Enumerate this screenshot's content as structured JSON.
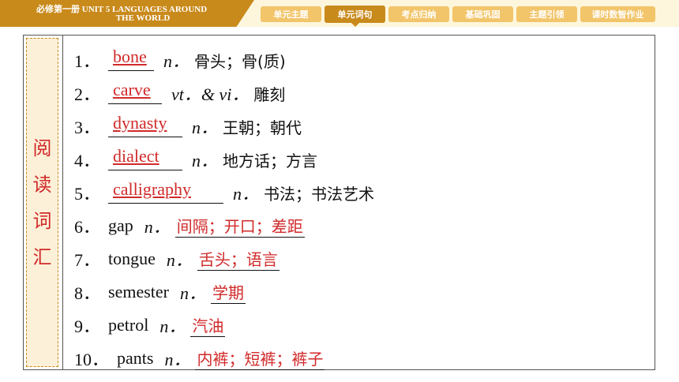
{
  "header": {
    "title_line1": "必修第一册    UNIT 5    LANGUAGES AROUND",
    "title_line2": "THE WORLD",
    "tabs": [
      "单元主题",
      "单元词句",
      "考点归纳",
      "基础巩固",
      "主题引领",
      "课时数智作业"
    ],
    "active_tab_index": 1
  },
  "side_label": [
    "阅",
    "读",
    "词",
    "汇"
  ],
  "vocab": [
    {
      "num": "1．",
      "answer": "bone",
      "pos": "n．",
      "meaning": "骨头；骨(质)"
    },
    {
      "num": "2．",
      "answer": "carve",
      "pos": "vt．& vi．",
      "meaning": "雕刻"
    },
    {
      "num": "3．",
      "answer": "dynasty",
      "pos": "n．",
      "meaning": "王朝；朝代"
    },
    {
      "num": "4．",
      "answer": "dialect",
      "pos": "n．",
      "meaning": "地方话；方言"
    },
    {
      "num": "5．",
      "answer": "calligraphy",
      "pos": "n．",
      "meaning": "书法；书法艺术"
    },
    {
      "num": "6．",
      "word": "gap",
      "pos": "n．",
      "answer": "间隔；开口；差距"
    },
    {
      "num": "7．",
      "word": "tongue",
      "pos": "n．",
      "answer": "舌头；语言"
    },
    {
      "num": "8．",
      "word": "semester",
      "pos": "n．",
      "answer": "学期"
    },
    {
      "num": "9．",
      "word": "petrol",
      "pos": "n．",
      "answer": "汽油"
    },
    {
      "num": "10．",
      "word": "pants",
      "pos": "n．",
      "answer": "内裤；短裤；裤子"
    }
  ],
  "colors": {
    "accent": "#c98a1c",
    "tab_inactive": "#f2c56a",
    "topbar_bg": "#fdf6dc",
    "answer_red": "#d12a2a",
    "side_bg": "#fdf0d8"
  }
}
